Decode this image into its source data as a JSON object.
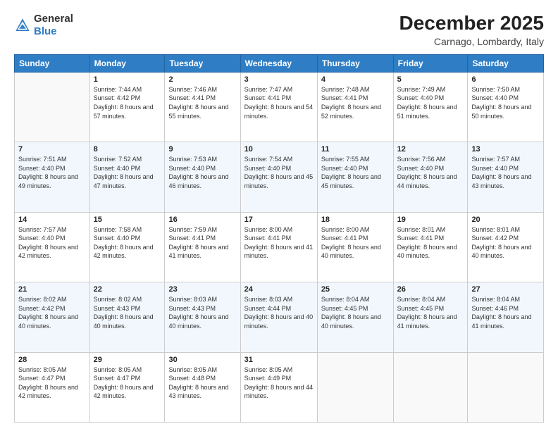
{
  "header": {
    "logo_general": "General",
    "logo_blue": "Blue",
    "month": "December 2025",
    "location": "Carnago, Lombardy, Italy"
  },
  "days_of_week": [
    "Sunday",
    "Monday",
    "Tuesday",
    "Wednesday",
    "Thursday",
    "Friday",
    "Saturday"
  ],
  "weeks": [
    [
      {
        "day": "",
        "empty": true
      },
      {
        "day": "1",
        "sunrise": "Sunrise: 7:44 AM",
        "sunset": "Sunset: 4:42 PM",
        "daylight": "Daylight: 8 hours and 57 minutes."
      },
      {
        "day": "2",
        "sunrise": "Sunrise: 7:46 AM",
        "sunset": "Sunset: 4:41 PM",
        "daylight": "Daylight: 8 hours and 55 minutes."
      },
      {
        "day": "3",
        "sunrise": "Sunrise: 7:47 AM",
        "sunset": "Sunset: 4:41 PM",
        "daylight": "Daylight: 8 hours and 54 minutes."
      },
      {
        "day": "4",
        "sunrise": "Sunrise: 7:48 AM",
        "sunset": "Sunset: 4:41 PM",
        "daylight": "Daylight: 8 hours and 52 minutes."
      },
      {
        "day": "5",
        "sunrise": "Sunrise: 7:49 AM",
        "sunset": "Sunset: 4:40 PM",
        "daylight": "Daylight: 8 hours and 51 minutes."
      },
      {
        "day": "6",
        "sunrise": "Sunrise: 7:50 AM",
        "sunset": "Sunset: 4:40 PM",
        "daylight": "Daylight: 8 hours and 50 minutes."
      }
    ],
    [
      {
        "day": "7",
        "sunrise": "Sunrise: 7:51 AM",
        "sunset": "Sunset: 4:40 PM",
        "daylight": "Daylight: 8 hours and 49 minutes."
      },
      {
        "day": "8",
        "sunrise": "Sunrise: 7:52 AM",
        "sunset": "Sunset: 4:40 PM",
        "daylight": "Daylight: 8 hours and 47 minutes."
      },
      {
        "day": "9",
        "sunrise": "Sunrise: 7:53 AM",
        "sunset": "Sunset: 4:40 PM",
        "daylight": "Daylight: 8 hours and 46 minutes."
      },
      {
        "day": "10",
        "sunrise": "Sunrise: 7:54 AM",
        "sunset": "Sunset: 4:40 PM",
        "daylight": "Daylight: 8 hours and 45 minutes."
      },
      {
        "day": "11",
        "sunrise": "Sunrise: 7:55 AM",
        "sunset": "Sunset: 4:40 PM",
        "daylight": "Daylight: 8 hours and 45 minutes."
      },
      {
        "day": "12",
        "sunrise": "Sunrise: 7:56 AM",
        "sunset": "Sunset: 4:40 PM",
        "daylight": "Daylight: 8 hours and 44 minutes."
      },
      {
        "day": "13",
        "sunrise": "Sunrise: 7:57 AM",
        "sunset": "Sunset: 4:40 PM",
        "daylight": "Daylight: 8 hours and 43 minutes."
      }
    ],
    [
      {
        "day": "14",
        "sunrise": "Sunrise: 7:57 AM",
        "sunset": "Sunset: 4:40 PM",
        "daylight": "Daylight: 8 hours and 42 minutes."
      },
      {
        "day": "15",
        "sunrise": "Sunrise: 7:58 AM",
        "sunset": "Sunset: 4:40 PM",
        "daylight": "Daylight: 8 hours and 42 minutes."
      },
      {
        "day": "16",
        "sunrise": "Sunrise: 7:59 AM",
        "sunset": "Sunset: 4:41 PM",
        "daylight": "Daylight: 8 hours and 41 minutes."
      },
      {
        "day": "17",
        "sunrise": "Sunrise: 8:00 AM",
        "sunset": "Sunset: 4:41 PM",
        "daylight": "Daylight: 8 hours and 41 minutes."
      },
      {
        "day": "18",
        "sunrise": "Sunrise: 8:00 AM",
        "sunset": "Sunset: 4:41 PM",
        "daylight": "Daylight: 8 hours and 40 minutes."
      },
      {
        "day": "19",
        "sunrise": "Sunrise: 8:01 AM",
        "sunset": "Sunset: 4:41 PM",
        "daylight": "Daylight: 8 hours and 40 minutes."
      },
      {
        "day": "20",
        "sunrise": "Sunrise: 8:01 AM",
        "sunset": "Sunset: 4:42 PM",
        "daylight": "Daylight: 8 hours and 40 minutes."
      }
    ],
    [
      {
        "day": "21",
        "sunrise": "Sunrise: 8:02 AM",
        "sunset": "Sunset: 4:42 PM",
        "daylight": "Daylight: 8 hours and 40 minutes."
      },
      {
        "day": "22",
        "sunrise": "Sunrise: 8:02 AM",
        "sunset": "Sunset: 4:43 PM",
        "daylight": "Daylight: 8 hours and 40 minutes."
      },
      {
        "day": "23",
        "sunrise": "Sunrise: 8:03 AM",
        "sunset": "Sunset: 4:43 PM",
        "daylight": "Daylight: 8 hours and 40 minutes."
      },
      {
        "day": "24",
        "sunrise": "Sunrise: 8:03 AM",
        "sunset": "Sunset: 4:44 PM",
        "daylight": "Daylight: 8 hours and 40 minutes."
      },
      {
        "day": "25",
        "sunrise": "Sunrise: 8:04 AM",
        "sunset": "Sunset: 4:45 PM",
        "daylight": "Daylight: 8 hours and 40 minutes."
      },
      {
        "day": "26",
        "sunrise": "Sunrise: 8:04 AM",
        "sunset": "Sunset: 4:45 PM",
        "daylight": "Daylight: 8 hours and 41 minutes."
      },
      {
        "day": "27",
        "sunrise": "Sunrise: 8:04 AM",
        "sunset": "Sunset: 4:46 PM",
        "daylight": "Daylight: 8 hours and 41 minutes."
      }
    ],
    [
      {
        "day": "28",
        "sunrise": "Sunrise: 8:05 AM",
        "sunset": "Sunset: 4:47 PM",
        "daylight": "Daylight: 8 hours and 42 minutes."
      },
      {
        "day": "29",
        "sunrise": "Sunrise: 8:05 AM",
        "sunset": "Sunset: 4:47 PM",
        "daylight": "Daylight: 8 hours and 42 minutes."
      },
      {
        "day": "30",
        "sunrise": "Sunrise: 8:05 AM",
        "sunset": "Sunset: 4:48 PM",
        "daylight": "Daylight: 8 hours and 43 minutes."
      },
      {
        "day": "31",
        "sunrise": "Sunrise: 8:05 AM",
        "sunset": "Sunset: 4:49 PM",
        "daylight": "Daylight: 8 hours and 44 minutes."
      },
      {
        "day": "",
        "empty": true
      },
      {
        "day": "",
        "empty": true
      },
      {
        "day": "",
        "empty": true
      }
    ]
  ]
}
